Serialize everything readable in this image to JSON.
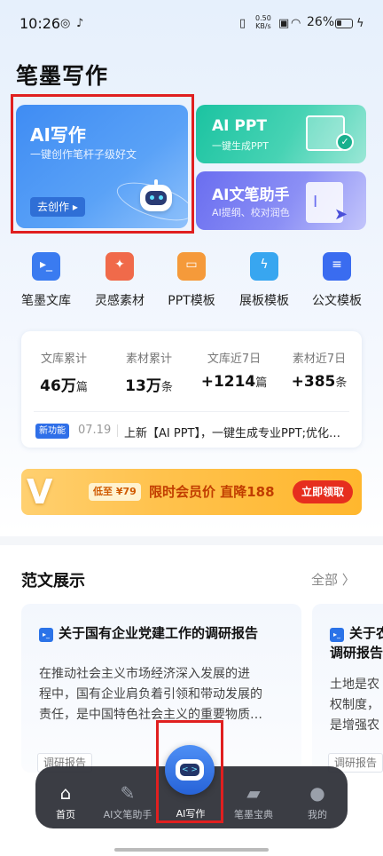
{
  "status_bar": {
    "time": "10:26",
    "net_speed_value": "0.50",
    "net_speed_unit": "KB/s",
    "battery_text": "26%"
  },
  "app": {
    "title": "笔墨写作"
  },
  "feature_cards": {
    "ai_writing": {
      "title": "AI写作",
      "subtitle": "一键创作笔杆子级好文",
      "button": "去创作 ▸"
    },
    "ai_ppt": {
      "title": "AI PPT",
      "subtitle": "一键生成PPT"
    },
    "ai_assistant": {
      "title": "AI文笔助手",
      "subtitle": "AI提纲、校对润色"
    }
  },
  "tools": [
    {
      "label": "笔墨文库",
      "icon": "library-icon",
      "color": "#3a7bf0"
    },
    {
      "label": "灵感素材",
      "icon": "inspiration-icon",
      "color": "#f06a4a"
    },
    {
      "label": "PPT模板",
      "icon": "ppt-template-icon",
      "color": "#f59a3a"
    },
    {
      "label": "展板模板",
      "icon": "board-template-icon",
      "color": "#38a6f0"
    },
    {
      "label": "公文模板",
      "icon": "official-doc-icon",
      "color": "#3a6cf0"
    }
  ],
  "stats": [
    {
      "label": "文库累计",
      "value": "46万",
      "unit": "篇"
    },
    {
      "label": "素材累计",
      "value": "13万",
      "unit": "条"
    },
    {
      "label": "文库近7日",
      "value": "+1214",
      "unit": "篇"
    },
    {
      "label": "素材近7日",
      "value": "+385",
      "unit": "条"
    }
  ],
  "news": {
    "badge": "新功能",
    "date": "07.19",
    "text": "上新【AI PPT】，一键生成专业PPT;优化部分功能"
  },
  "promo": {
    "price": "低至 ¥79",
    "headline": "限时会员价 直降188",
    "button": "立即领取"
  },
  "examples": {
    "title": "范文展示",
    "all_label": "全部 〉",
    "items": [
      {
        "title_line1": "关于国有企业党建工作的调研报告",
        "title_line2": "",
        "body": [
          "在推动社会主义市场经济深入发展的进",
          "程中，国有企业肩负着引领和带动发展的",
          "责任，是中国特色社会主义的重要物质…"
        ],
        "tag": "调研报告"
      },
      {
        "title_line1": "关于农",
        "title_line2": "调研报告",
        "body": [
          "土地是农",
          "权制度，",
          "是增强农"
        ],
        "tag": "调研报告"
      }
    ]
  },
  "tabbar": {
    "items": [
      {
        "label": "首页",
        "icon": "home-icon"
      },
      {
        "label": "AI文笔助手",
        "icon": "brush-icon"
      },
      {
        "label": "AI写作",
        "icon": "robot-icon"
      },
      {
        "label": "笔墨宝典",
        "icon": "folder-icon"
      },
      {
        "label": "我的",
        "icon": "user-icon"
      }
    ]
  },
  "colors": {
    "accent": "#3f8cf3",
    "highlight_box": "#e01f1f"
  }
}
